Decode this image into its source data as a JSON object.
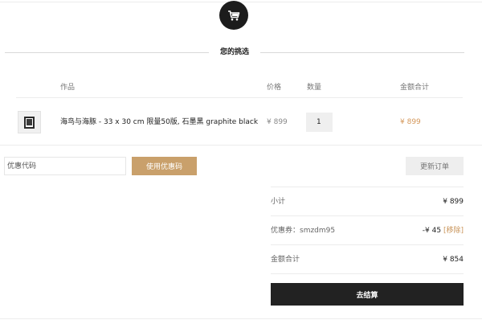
{
  "cart_icon": "cart-icon",
  "section_title": "您的挑选",
  "table": {
    "headers": {
      "work": "作品",
      "price": "价格",
      "qty": "数量",
      "total": "金额合计"
    },
    "rows": [
      {
        "name": "海鸟与海豚 - 33 x 30 cm 限量50版, 石墨黑 graphite black",
        "price": "¥ 899",
        "qty": "1",
        "total": "¥ 899"
      }
    ]
  },
  "coupon": {
    "placeholder": "优惠代码",
    "apply_label": "使用优惠码",
    "update_label": "更新订单"
  },
  "summary": {
    "subtotal_label": "小计",
    "subtotal_value": "¥ 899",
    "coupon_label": "优惠券：smzdm95",
    "coupon_value": "-¥ 45",
    "remove_label": "[移除]",
    "grand_total_label": "金额合计",
    "grand_total_value": "¥ 854"
  },
  "checkout_label": "去结算",
  "colors": {
    "accent_gold": "#c9a06b",
    "total_orange": "#d4975a",
    "dark": "#222222"
  }
}
